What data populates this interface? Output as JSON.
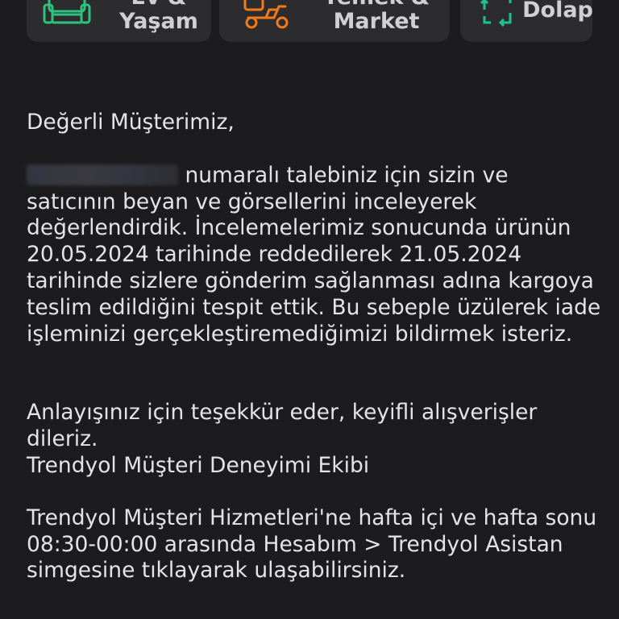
{
  "categories": [
    {
      "label_line1": "Ev &",
      "label_line2": "Yaşam",
      "icon": "sofa-icon",
      "accent": "#2ec27e"
    },
    {
      "label_line1": "Yemek &",
      "label_line2": "Market",
      "icon": "delivery-scooter-icon",
      "accent": "#f27a1a"
    },
    {
      "label_line1": "Dolap",
      "label_line2": "",
      "icon": "recycle-hanger-icon",
      "accent": "#1fbf8f"
    }
  ],
  "message": {
    "greeting": "Değerli Müşterimiz,",
    "body_after_redacted": "numaralı talebiniz için sizin ve satıcının beyan ve görsellerini inceleyerek değerlendirdik. İncelemelerimiz sonucunda ürünün 20.05.2024 tarihinde reddedilerek 21.05.2024 tarihinde sizlere gönderim sağlanması adına kargoya teslim edildiğini tespit ettik. Bu sebeple üzülerek iade işleminizi gerçekleştiremediğimizi bildirmek isteriz.",
    "thanks": "Anlayışınız için teşekkür eder, keyifli alışverişler dileriz.",
    "signature": "Trendyol Müşteri Deneyimi Ekibi",
    "support_info": "Trendyol Müşteri Hizmetleri'ne hafta içi ve hafta sonu 08:30-00:00 arasında Hesabım > Trendyol Asistan simgesine tıklayarak ulaşabilirsiniz."
  },
  "colors": {
    "background": "#1c1c1e",
    "card": "#2c2c2e",
    "text": "#e4e4e6"
  }
}
